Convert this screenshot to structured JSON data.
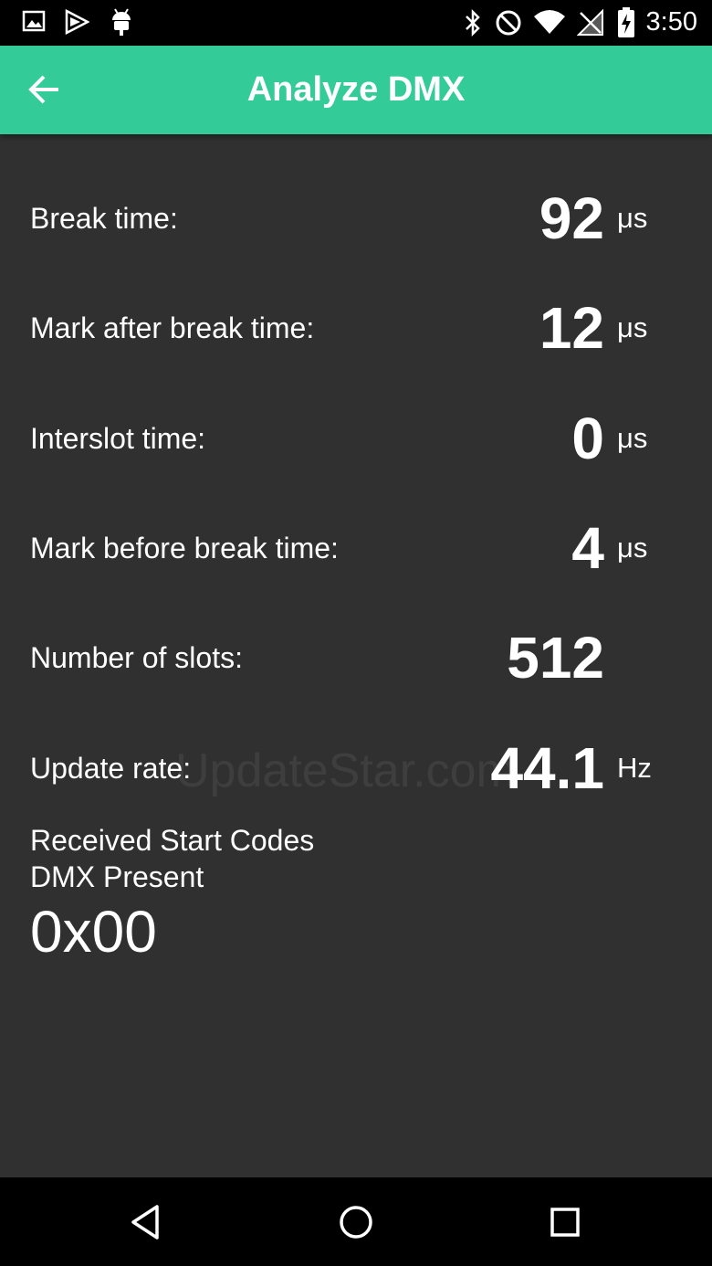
{
  "status_bar": {
    "time": "3:50",
    "left_icons": [
      "image-icon",
      "play-store-icon",
      "android-icon"
    ],
    "right_icons": [
      "bluetooth-icon",
      "do-not-disturb-icon",
      "wifi-icon",
      "no-signal-icon",
      "battery-charging-icon"
    ]
  },
  "app_bar": {
    "title": "Analyze DMX",
    "back_icon": "arrow-left-icon",
    "color": "#33cc99"
  },
  "measurements": [
    {
      "label": "Break time:",
      "value": "92",
      "unit": "μs"
    },
    {
      "label": "Mark after break time:",
      "value": "12",
      "unit": "μs"
    },
    {
      "label": "Interslot time:",
      "value": "0",
      "unit": "μs"
    },
    {
      "label": "Mark before break time:",
      "value": "4",
      "unit": "μs"
    },
    {
      "label": "Number of slots:",
      "value": "512",
      "unit": ""
    },
    {
      "label": "Update rate:",
      "value": "44.1",
      "unit": "Hz"
    }
  ],
  "start_codes": {
    "title": "Received Start Codes",
    "status": "DMX Present",
    "code": "0x00"
  },
  "watermark": "UpdateStar.com",
  "nav_bar": {
    "icons": [
      "back-triangle-icon",
      "home-circle-icon",
      "recents-square-icon"
    ]
  },
  "colors": {
    "background": "#303030",
    "accent": "#33cc99",
    "text": "#ffffff"
  }
}
